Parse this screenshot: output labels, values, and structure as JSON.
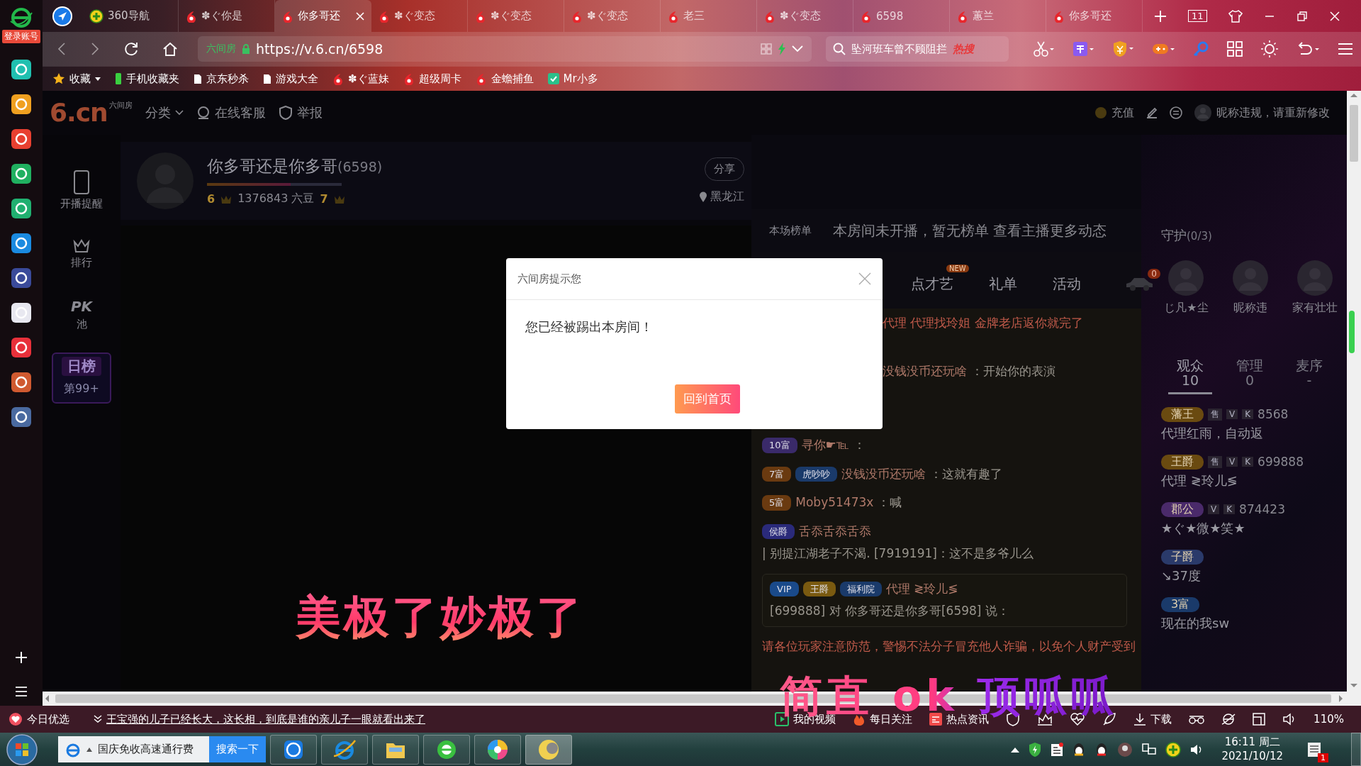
{
  "browser": {
    "login": "登录账号",
    "tabs": [
      {
        "kind": "nav360",
        "label": "360导航",
        "selected": false
      },
      {
        "kind": "six",
        "label": "✽ぐ你是",
        "selected": false
      },
      {
        "kind": "six",
        "label": "你多哥还",
        "selected": true
      },
      {
        "kind": "six",
        "label": "✽ぐ变态",
        "selected": false
      },
      {
        "kind": "six",
        "label": "✽ぐ变态",
        "selected": false
      },
      {
        "kind": "six",
        "label": "✽ぐ变态",
        "selected": false
      },
      {
        "kind": "six",
        "label": "老三",
        "selected": false
      },
      {
        "kind": "six",
        "label": "✽ぐ变态",
        "selected": false
      },
      {
        "kind": "six",
        "label": "6598",
        "selected": false
      },
      {
        "kind": "six",
        "label": "蕙兰",
        "selected": false
      },
      {
        "kind": "six",
        "label": "你多哥还",
        "selected": false
      }
    ],
    "tab_count": "11",
    "address": {
      "site": "六间房",
      "url": "https://v.6.cn/6598"
    },
    "search": {
      "value": "坠河班车曾不顾阻拦",
      "tag": "热搜"
    },
    "bookmarks": [
      {
        "kind": "star",
        "label": "收藏"
      },
      {
        "kind": "phone",
        "label": "手机收藏夹"
      },
      {
        "kind": "page",
        "label": "京东秒杀"
      },
      {
        "kind": "page",
        "label": "游戏大全"
      },
      {
        "kind": "six",
        "label": "✽ぐ蓝妹"
      },
      {
        "kind": "six",
        "label": "超级周卡"
      },
      {
        "kind": "six",
        "label": "金蟾捕鱼"
      },
      {
        "kind": "app",
        "label": "Mr小多"
      }
    ]
  },
  "page": {
    "header": {
      "logo_caption": "六间房",
      "logo": "6.cn",
      "nav": [
        "分类",
        "在线客服",
        "举报"
      ],
      "recharge": "充值",
      "nickname_notice": "昵称违规，请重新修改"
    },
    "side_nav": [
      {
        "kind": "phone",
        "label": "开播提醒"
      },
      {
        "kind": "crown",
        "label": "排行"
      },
      {
        "kind": "pk",
        "title": "PK",
        "label": "池"
      }
    ],
    "daily_rank": {
      "title": "日榜",
      "rank": "第99+"
    },
    "anchor": {
      "name": "你多哥还是你多哥",
      "room_id": "(6598)",
      "level": 0.62,
      "anchor_level": "6",
      "beans": "1376843 六豆",
      "wealth_level": "7",
      "share": "分享",
      "location": "黑龙江"
    },
    "video": {
      "caption": "美极了妙极了"
    },
    "chat": {
      "rank_title": "本场榜单",
      "rank_message": "本房间未开播，暂无榜单  查看主播更多动态",
      "tabs": [
        {
          "label": "点才艺",
          "badge": "NEW"
        },
        {
          "label": "礼单"
        },
        {
          "label": "活动"
        }
      ],
      "car_count": "0",
      "messages": [
        {
          "kind": "system",
          "text": "代理 代理找玲姐 金牌老店返你就完了"
        },
        {
          "kind": "message",
          "user": "没钱没币还玩啥",
          "text": "：开始你的表演"
        },
        {
          "kind": "message",
          "badges": [
            {
              "text": "10富",
              "color": "#3a2a6a"
            }
          ],
          "user": "寻你☛℡",
          "text": "："
        },
        {
          "kind": "message",
          "badges": [
            {
              "text": "7富",
              "color": "#6a3a10"
            },
            {
              "text": "虎吵吵",
              "color": "#1a3a6a"
            }
          ],
          "user": "没钱没币还玩啥",
          "text": "：这就有趣了"
        },
        {
          "kind": "message",
          "badges": [
            {
              "text": "5富",
              "color": "#6a3a10"
            }
          ],
          "user": "Moby51473x",
          "text": "：喊"
        },
        {
          "kind": "message",
          "badges": [
            {
              "text": "侯爵",
              "color": "#2a2a7a"
            }
          ],
          "user": "舌忝舌忝舌忝",
          "text": "| 别提江湖老子不渴. [7919191]：这不是多爷儿么"
        },
        {
          "kind": "vip",
          "badges": [
            {
              "text": "VIP",
              "color": "#1a4a8a"
            },
            {
              "text": "王爵",
              "color": "#7a5a10"
            },
            {
              "text": "福利院",
              "color": "#1a3a6a"
            }
          ],
          "user": "代理 ≷玲儿≶",
          "text": "[699888] 对 你多哥还是你多哥[6598] 说："
        },
        {
          "kind": "notice",
          "text": "请各位玩家注意防范，警惕不法分子冒充他人诈骗，以免个人财产受到"
        }
      ]
    },
    "guard": {
      "title": "守护",
      "count": "(0/3)",
      "members": [
        "じ凡★尘",
        "昵称违",
        "家有壮壮"
      ]
    },
    "audience": {
      "tabs": [
        {
          "label": "观众",
          "count": "10",
          "selected": true
        },
        {
          "label": "管理",
          "count": "0",
          "selected": false
        },
        {
          "label": "麦序",
          "count": "-",
          "selected": false
        }
      ],
      "rows": [
        {
          "rank": "藩王",
          "color": "#6a4a10",
          "badges": [
            "售",
            "V",
            "K"
          ],
          "id": "8568",
          "name": "代理红雨，自动返"
        },
        {
          "rank": "王爵",
          "color": "#6a4a10",
          "badges": [
            "售",
            "V",
            "K"
          ],
          "id": "699888",
          "name": "代理 ≷玲儿≶"
        },
        {
          "rank": "郡公",
          "color": "#4a2a6a",
          "badges": [
            "V",
            "K"
          ],
          "id": "874423",
          "name": "★ぐ★微★笑★"
        },
        {
          "rank": "子爵",
          "color": "#2a3a6a",
          "name": "↘37度"
        },
        {
          "rank": "3富",
          "color": "#1a3a6a",
          "name": "现在的我sw"
        }
      ]
    }
  },
  "dialog": {
    "title": "六间房提示您",
    "message": "您已经被踢出本房间！",
    "button": "回到首页"
  },
  "bullet": "简直 ok 顶呱呱",
  "status_bar": {
    "pick": "今日优选",
    "news": "王宝强的儿子已经长大，这长相，到底是谁的亲儿子一眼就看出来了",
    "links": [
      "我的视频",
      "每日关注",
      "热点资讯"
    ],
    "download": "下载",
    "zoom": "110%"
  },
  "taskbar": {
    "search": "国庆免收高速通行费",
    "search_button": "搜索一下",
    "time": "16:11 周二",
    "date": "2021/10/12",
    "notifications": "1"
  }
}
